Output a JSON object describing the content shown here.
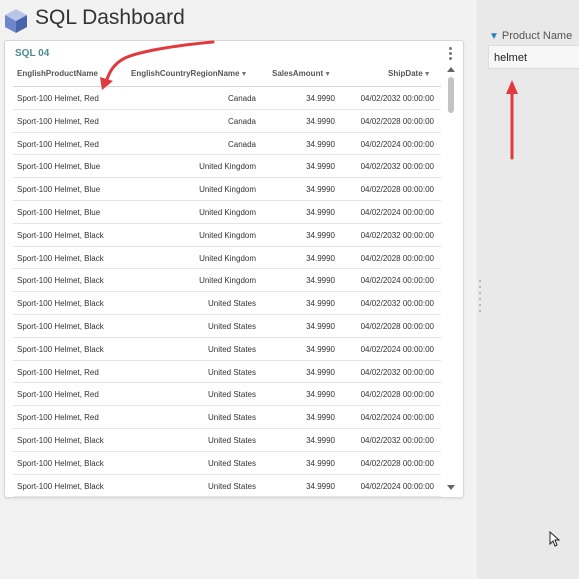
{
  "page": {
    "title": "SQL Dashboard"
  },
  "filter": {
    "label": "Product Name",
    "value": "helmet"
  },
  "widget": {
    "title": "SQL 04",
    "columns": [
      "EnglishProductName",
      "EnglishCountryRegionName",
      "SalesAmount",
      "ShipDate"
    ],
    "rows": [
      [
        "Sport-100 Helmet, Red",
        "Canada",
        "34.9990",
        "04/02/2032 00:00:00"
      ],
      [
        "Sport-100 Helmet, Red",
        "Canada",
        "34.9990",
        "04/02/2028 00:00:00"
      ],
      [
        "Sport-100 Helmet, Red",
        "Canada",
        "34.9990",
        "04/02/2024 00:00:00"
      ],
      [
        "Sport-100 Helmet, Blue",
        "United Kingdom",
        "34.9990",
        "04/02/2032 00:00:00"
      ],
      [
        "Sport-100 Helmet, Blue",
        "United Kingdom",
        "34.9990",
        "04/02/2028 00:00:00"
      ],
      [
        "Sport-100 Helmet, Blue",
        "United Kingdom",
        "34.9990",
        "04/02/2024 00:00:00"
      ],
      [
        "Sport-100 Helmet, Black",
        "United Kingdom",
        "34.9990",
        "04/02/2032 00:00:00"
      ],
      [
        "Sport-100 Helmet, Black",
        "United Kingdom",
        "34.9990",
        "04/02/2028 00:00:00"
      ],
      [
        "Sport-100 Helmet, Black",
        "United Kingdom",
        "34.9990",
        "04/02/2024 00:00:00"
      ],
      [
        "Sport-100 Helmet, Black",
        "United States",
        "34.9990",
        "04/02/2032 00:00:00"
      ],
      [
        "Sport-100 Helmet, Black",
        "United States",
        "34.9990",
        "04/02/2028 00:00:00"
      ],
      [
        "Sport-100 Helmet, Black",
        "United States",
        "34.9990",
        "04/02/2024 00:00:00"
      ],
      [
        "Sport-100 Helmet, Red",
        "United States",
        "34.9990",
        "04/02/2032 00:00:00"
      ],
      [
        "Sport-100 Helmet, Red",
        "United States",
        "34.9990",
        "04/02/2028 00:00:00"
      ],
      [
        "Sport-100 Helmet, Red",
        "United States",
        "34.9990",
        "04/02/2024 00:00:00"
      ],
      [
        "Sport-100 Helmet, Black",
        "United States",
        "34.9990",
        "04/02/2032 00:00:00"
      ],
      [
        "Sport-100 Helmet, Black",
        "United States",
        "34.9990",
        "04/02/2028 00:00:00"
      ],
      [
        "Sport-100 Helmet, Black",
        "United States",
        "34.9990",
        "04/02/2024 00:00:00"
      ]
    ]
  },
  "icons": {
    "logo": "cube-logo-icon",
    "filter": "funnel-icon",
    "menu": "kebab-menu-icon",
    "sort": "caret-down-icon",
    "cursor": "mouse-pointer-icon",
    "annotation": "red-arrow-annotation"
  },
  "colors": {
    "accent": "#4a8a96",
    "annotation": "#e03a3e",
    "filter_icon": "#2f80c0"
  }
}
